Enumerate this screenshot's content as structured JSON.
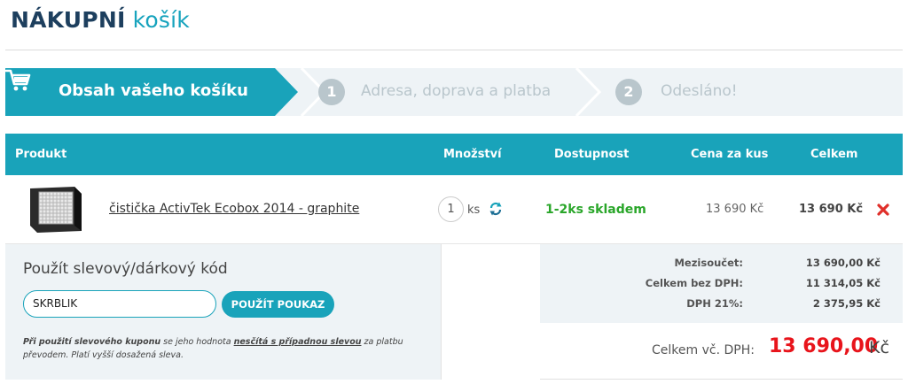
{
  "header": {
    "title_bold": "NÁKUPNÍ",
    "title_light": "košík"
  },
  "steps": [
    {
      "label": "Obsah vašeho košíku",
      "icon": "cart-icon",
      "active": true
    },
    {
      "number": "1",
      "label": "Adresa, doprava a platba",
      "active": false
    },
    {
      "number": "2",
      "label": "Odesláno!",
      "active": false
    }
  ],
  "table": {
    "headers": {
      "product": "Produkt",
      "quantity": "Množství",
      "availability": "Dostupnost",
      "unit_price": "Cena za kus",
      "total": "Celkem"
    },
    "rows": [
      {
        "name": "čistička ActivTek Ecobox 2014 - graphite",
        "quantity": "1",
        "unit": "ks",
        "availability": "1-2ks skladem",
        "unit_price": "13 690 Kč",
        "total": "13 690 Kč"
      }
    ]
  },
  "coupon": {
    "title": "Použít slevový/dárkový kód",
    "value": "SKRBLIK",
    "button": "POUŽÍT POUKAZ",
    "note_bold": "Při použití slevového kuponu",
    "note_mid": " se jeho hodnota ",
    "note_underline": "nesčítá s případnou slevou",
    "note_end": " za platbu převodem. Platí vyšší dosažená sleva."
  },
  "summary": {
    "subtotal_label": "Mezisoučet:",
    "subtotal_value": "13 690,00 Kč",
    "no_vat_label": "Celkem bez DPH:",
    "no_vat_value": "11 314,05 Kč",
    "vat_label": "DPH 21%:",
    "vat_value": "2 375,95 Kč",
    "grand_label": "Celkem vč. DPH:",
    "grand_value": "13 690,00",
    "grand_currency": "Kč"
  },
  "colors": {
    "accent": "#19a3ba",
    "title_dark": "#1d3f5e",
    "in_stock": "#2aa62a",
    "total_red": "#e8141b",
    "panel_bg": "#eef3f6"
  }
}
